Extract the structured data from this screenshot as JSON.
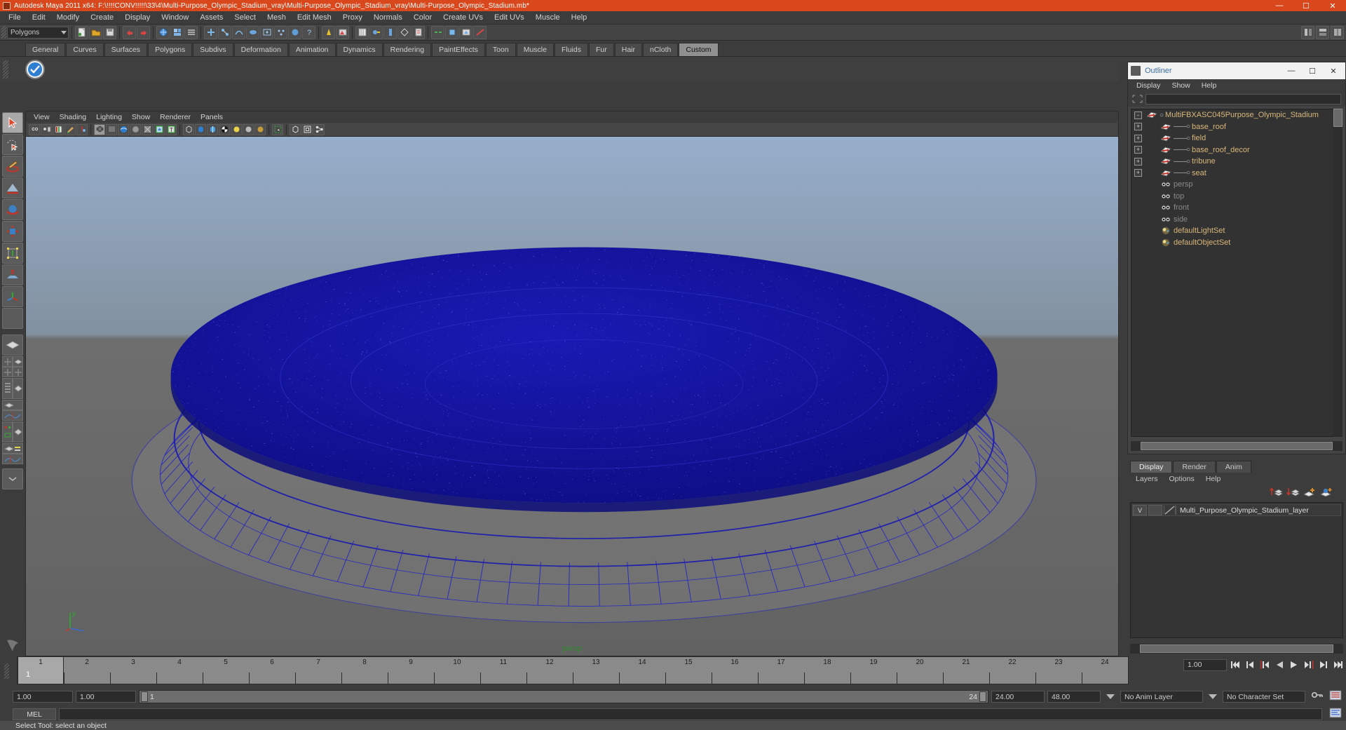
{
  "window": {
    "title": "Autodesk Maya 2011 x64: F:\\!!!!CONV!!!!!\\33\\4\\Multi-Purpose_Olympic_Stadium_vray\\Multi-Purpose_Olympic_Stadium_vray\\Multi-Purpose_Olympic_Stadium.mb*",
    "minimize": "—",
    "maximize": "☐",
    "close": "✕",
    "titlebar_color": "#d8481c"
  },
  "menubar": {
    "items": [
      "File",
      "Edit",
      "Modify",
      "Create",
      "Display",
      "Window",
      "Assets",
      "Select",
      "Mesh",
      "Edit Mesh",
      "Proxy",
      "Normals",
      "Color",
      "Create UVs",
      "Edit UVs",
      "Muscle",
      "Help"
    ]
  },
  "statusbar": {
    "mode_selector": "Polygons"
  },
  "shelf": {
    "tabs": [
      "General",
      "Curves",
      "Surfaces",
      "Polygons",
      "Subdivs",
      "Deformation",
      "Animation",
      "Dynamics",
      "Rendering",
      "PaintEffects",
      "Toon",
      "Muscle",
      "Fluids",
      "Fur",
      "Hair",
      "nCloth",
      "Custom"
    ],
    "active_tab": "Custom"
  },
  "viewport": {
    "menus": [
      "View",
      "Shading",
      "Lighting",
      "Show",
      "Renderer",
      "Panels"
    ],
    "camera_label": "persp",
    "camera_label_color": "#2e8b2e",
    "axis_label": "y",
    "background_top": "#8fa8c8",
    "background_bottom": "#6a6a6a",
    "model_color": "#1414a8",
    "wire_color": "#2020c0"
  },
  "outliner": {
    "title": "Outliner",
    "menus": [
      "Display",
      "Show",
      "Help"
    ],
    "search_value": "",
    "minimize": "—",
    "maximize": "☐",
    "close": "✕",
    "tree": [
      {
        "label": "MultiFBXASC045Purpose_Olympic_Stadium",
        "indent": 0,
        "expander": "-",
        "icon": "transform-icon",
        "type": "mesh"
      },
      {
        "label": "base_roof",
        "indent": 1,
        "expander": "+",
        "icon": "transform-icon",
        "type": "mesh"
      },
      {
        "label": "field",
        "indent": 1,
        "expander": "+",
        "icon": "transform-icon",
        "type": "mesh"
      },
      {
        "label": "base_roof_decor",
        "indent": 1,
        "expander": "+",
        "icon": "transform-icon",
        "type": "mesh"
      },
      {
        "label": "tribune",
        "indent": 1,
        "expander": "+",
        "icon": "transform-icon",
        "type": "mesh"
      },
      {
        "label": "seat",
        "indent": 1,
        "expander": "+",
        "icon": "transform-icon",
        "type": "mesh"
      },
      {
        "label": "persp",
        "indent": 1,
        "expander": "",
        "icon": "camera-icon",
        "type": "camera"
      },
      {
        "label": "top",
        "indent": 1,
        "expander": "",
        "icon": "camera-icon",
        "type": "camera"
      },
      {
        "label": "front",
        "indent": 1,
        "expander": "",
        "icon": "camera-icon",
        "type": "camera"
      },
      {
        "label": "side",
        "indent": 1,
        "expander": "",
        "icon": "camera-icon",
        "type": "camera"
      },
      {
        "label": "defaultLightSet",
        "indent": 1,
        "expander": "",
        "icon": "set-icon",
        "type": "set"
      },
      {
        "label": "defaultObjectSet",
        "indent": 1,
        "expander": "",
        "icon": "set-icon",
        "type": "set"
      }
    ]
  },
  "layer_editor": {
    "tabs": [
      "Display",
      "Render",
      "Anim"
    ],
    "active_tab": "Display",
    "menus": [
      "Layers",
      "Options",
      "Help"
    ],
    "layers": [
      {
        "visibility": "V",
        "state": "",
        "name": "Multi_Purpose_Olympic_Stadium_layer"
      }
    ]
  },
  "timeline": {
    "ticks": [
      "1",
      "2",
      "3",
      "4",
      "5",
      "6",
      "7",
      "8",
      "9",
      "10",
      "11",
      "12",
      "13",
      "14",
      "15",
      "16",
      "17",
      "18",
      "19",
      "20",
      "21",
      "22",
      "23",
      "24"
    ],
    "current_frame_label": "1",
    "current_frame_field": "1.00"
  },
  "range": {
    "start": "1.00",
    "start2": "1.00",
    "range_start": "1",
    "range_end": "24",
    "end": "24.00",
    "playback_end": "48.00",
    "anim_layer": "No Anim Layer",
    "character_set": "No Character Set"
  },
  "command_line": {
    "language": "MEL",
    "value": ""
  },
  "status": {
    "message": "Select Tool: select an object"
  }
}
